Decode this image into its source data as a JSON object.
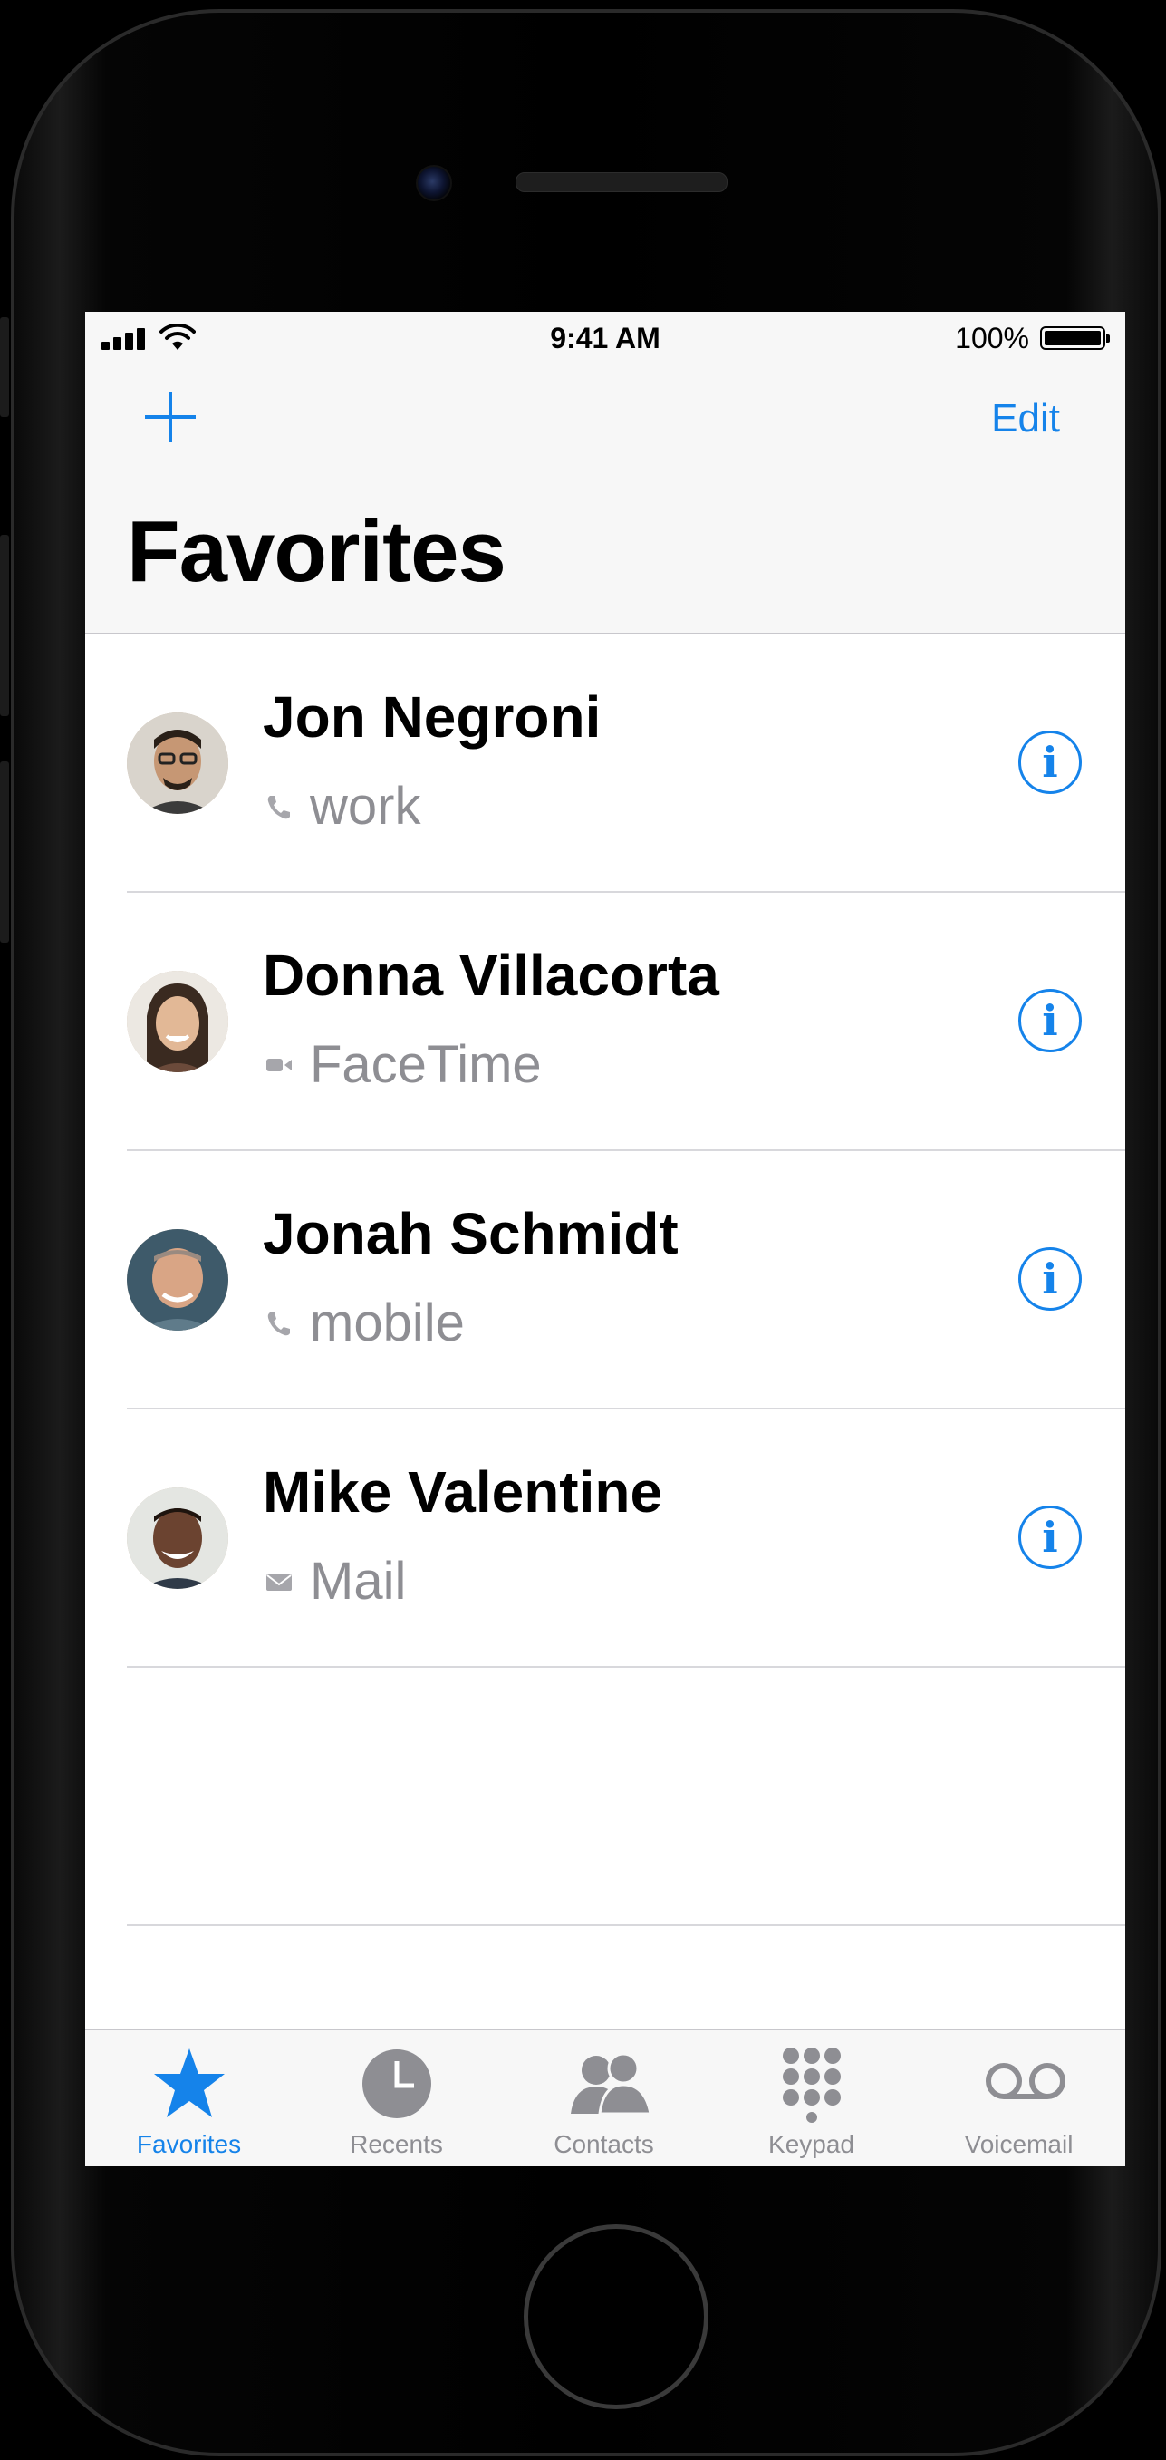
{
  "status_bar": {
    "time": "9:41 AM",
    "battery": "100%"
  },
  "nav": {
    "edit_label": "Edit",
    "title": "Favorites"
  },
  "favorites": [
    {
      "name": "Jon Negroni",
      "type": "work",
      "icon": "phone-icon"
    },
    {
      "name": "Donna Villacorta",
      "type": "FaceTime",
      "icon": "video-icon"
    },
    {
      "name": "Jonah Schmidt",
      "type": "mobile",
      "icon": "phone-icon"
    },
    {
      "name": "Mike Valentine",
      "type": "Mail",
      "icon": "mail-icon"
    }
  ],
  "tabs": [
    {
      "label": "Favorites",
      "icon": "star-icon",
      "active": true
    },
    {
      "label": "Recents",
      "icon": "clock-icon",
      "active": false
    },
    {
      "label": "Contacts",
      "icon": "people-icon",
      "active": false
    },
    {
      "label": "Keypad",
      "icon": "keypad-icon",
      "active": false
    },
    {
      "label": "Voicemail",
      "icon": "voicemail-icon",
      "active": false
    }
  ],
  "colors": {
    "accent": "#1583ea",
    "secondary_text": "#8e8e93",
    "bar_background": "#f7f7f7"
  }
}
